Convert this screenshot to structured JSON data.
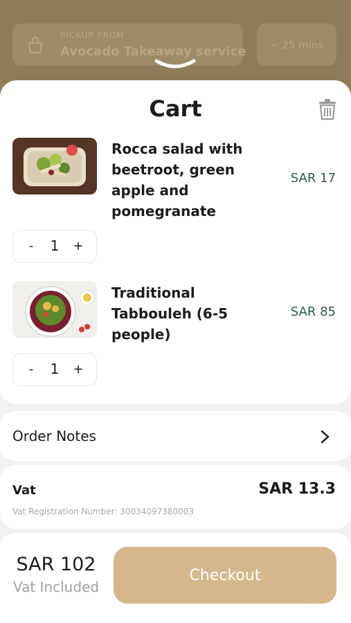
{
  "header": {
    "pickup_label": "PICKUP FROM",
    "pickup_name": "Avocado Takeaway service",
    "time_estimate": "~ 25 mins",
    "pickup_icon": "shopping-bag-icon",
    "handle_icon": "chevron-down-icon"
  },
  "cart": {
    "title": "Cart",
    "clear_icon": "trash-icon",
    "items": [
      {
        "name": "Rocca salad with beetroot, green apple and pomegranate",
        "price": "SAR 17",
        "quantity": "1",
        "minus": "-",
        "plus": "+"
      },
      {
        "name": "Traditional Tabbouleh (6-5 people)",
        "price": "SAR 85",
        "quantity": "1",
        "minus": "-",
        "plus": "+"
      }
    ]
  },
  "order_notes": {
    "label": "Order Notes",
    "icon": "chevron-right-icon"
  },
  "vat": {
    "label": "Vat",
    "amount": "SAR 13.3",
    "registration": "Vat Registration Number:   30034097380003"
  },
  "footer": {
    "total": "SAR 102",
    "vat_included": "Vat Included",
    "checkout_label": "Checkout"
  },
  "colors": {
    "accent": "#d4b88c",
    "price": "#2d5e3a",
    "overlay": "#8e7b5a"
  }
}
